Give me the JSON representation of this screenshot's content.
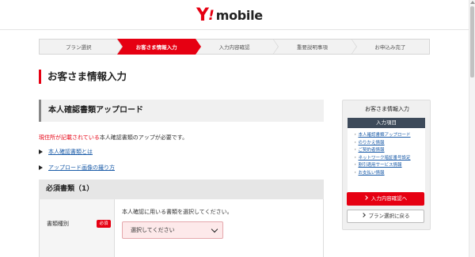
{
  "header": {
    "logo_y": "Y",
    "logo_bang": "!",
    "logo_text": "mobile"
  },
  "steps": [
    {
      "label": "プラン選択",
      "active": false
    },
    {
      "label": "お客さま情報入力",
      "active": true
    },
    {
      "label": "入力内容確認",
      "active": false
    },
    {
      "label": "重要説明事項",
      "active": false
    },
    {
      "label": "お申込み完了",
      "active": false
    }
  ],
  "page": {
    "title": "お客さま情報入力"
  },
  "main": {
    "section_title": "本人確認書類アップロード",
    "notice_red": "現住所が記載されている",
    "notice_rest": "本人確認書類のアップが必要です。",
    "links": [
      "本人確認書類とは",
      "アップロード画像の撮り方"
    ],
    "required_heading": "必須書類（1）",
    "field": {
      "label": "書類種別",
      "badge": "必須",
      "description": "本人確認に用いる書類を選択してください。",
      "select_value": "選択してください"
    }
  },
  "sidebar": {
    "title": "お客さま情報入力",
    "list_header": "入力項目",
    "items": [
      "本人確認書類アップロード",
      "のりかえ情報",
      "ご契約者情報",
      "ネットワーク暗証番号設定",
      "割引適用サービス情報",
      "お支払い情報"
    ],
    "confirm_button": "入力内容確認へ",
    "back_button": "プラン選択に戻る"
  },
  "colors": {
    "brand_red": "#e60012",
    "link_blue": "#1a5ba8",
    "sidebar_header": "#3d4a5a"
  }
}
